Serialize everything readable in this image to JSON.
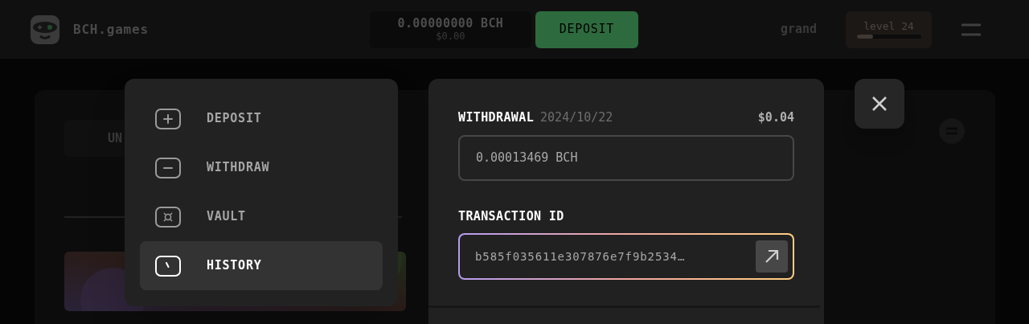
{
  "header": {
    "logo_text": "BCH.games",
    "balance": {
      "amount": "0.00000000 BCH",
      "usd": "$0.00"
    },
    "deposit_button": "DEPOSIT",
    "username": "grand",
    "level": {
      "label": "level 24",
      "level": 0.25
    }
  },
  "background": {
    "tab": "UN"
  },
  "menu": [
    {
      "label": "DEPOSIT",
      "kind": "plus",
      "selected": false
    },
    {
      "label": "WITHDRAW",
      "kind": "minus",
      "selected": false
    },
    {
      "label": "VAULT",
      "kind": "vault",
      "selected": false
    },
    {
      "label": "HISTORY",
      "kind": "clock",
      "selected": true
    }
  ],
  "detail": {
    "title": "WITHDRAWAL",
    "date": "2024/10/22",
    "usd": "$0.04",
    "amount": "0.00013469 BCH",
    "tx_label": "TRANSACTION ID",
    "tx_id": "b585f035611e307876e7f9b2534…"
  }
}
